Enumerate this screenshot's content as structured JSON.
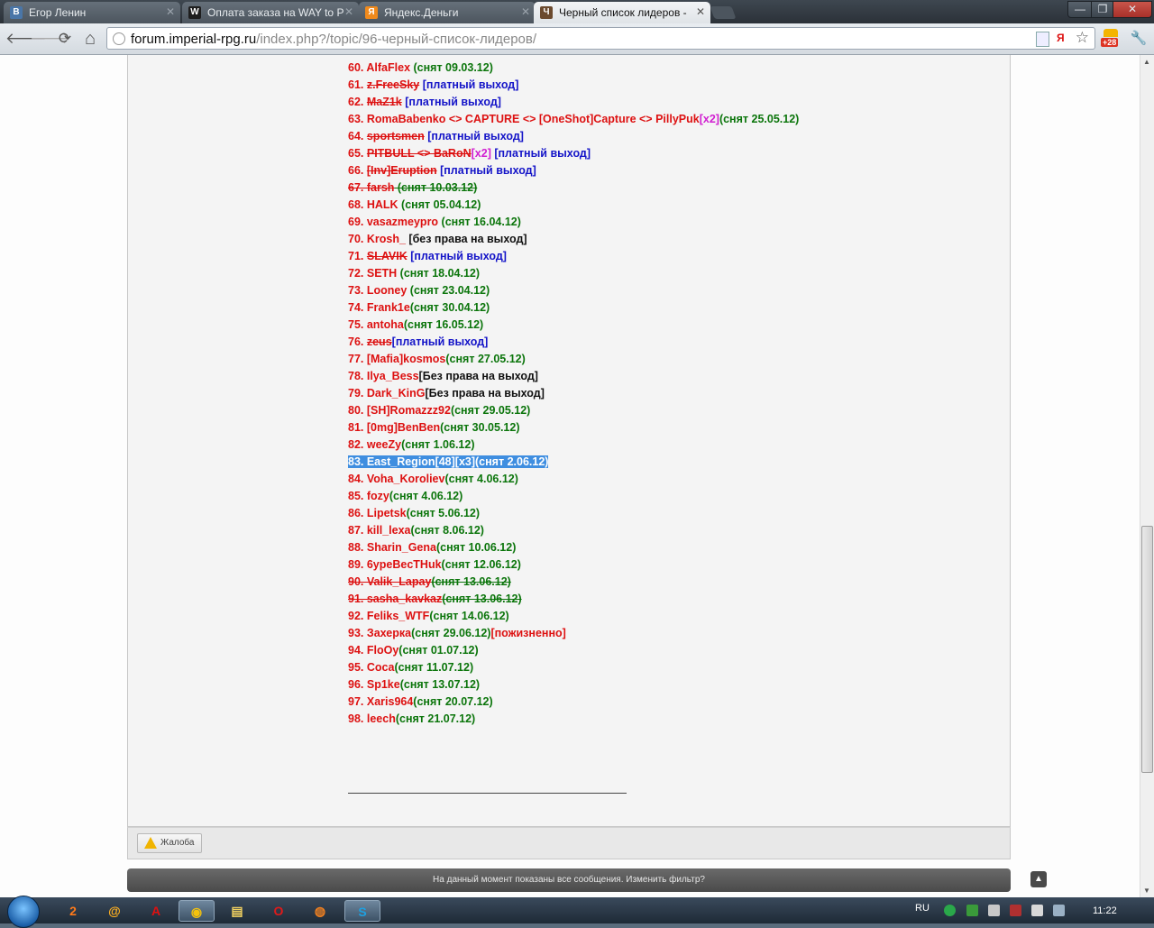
{
  "tabs": [
    {
      "title": "Егор Ленин",
      "fav_letter": "B",
      "fav_color": "#4a76a8"
    },
    {
      "title": "Оплата заказа на WAY to P",
      "fav_letter": "W",
      "fav_color": "#1e1e1e"
    },
    {
      "title": "Яндекс.Деньги",
      "fav_letter": "Я",
      "fav_color": "#f08a1c"
    },
    {
      "title": "Черный список лидеров -",
      "fav_letter": "Ч",
      "fav_color": "#6b4a2e"
    }
  ],
  "window_buttons": {
    "minimize": "—",
    "maximize": "❐",
    "close": "✕"
  },
  "toolbar": {
    "back": "🡐",
    "forward": "🡒",
    "reload": "⟳",
    "home": "⌂",
    "url_host": "forum.imperial-rpg.ru",
    "url_path": "/index.php?/topic/96-черный-список-лидеров/",
    "ext_badge": "+28",
    "bookmark_star": "☆",
    "wrench": "🔧"
  },
  "list": [
    {
      "segs": [
        {
          "t": "60. ",
          "c": "r"
        },
        {
          "t": "AlfaFlex",
          "c": "r"
        },
        {
          "t": " (снят 09.03.12)",
          "c": "g"
        }
      ]
    },
    {
      "segs": [
        {
          "t": "61. ",
          "c": "r"
        },
        {
          "t": "z.FreeSky",
          "c": "r s"
        },
        {
          "t": " [платный выход]",
          "c": "b"
        }
      ]
    },
    {
      "segs": [
        {
          "t": "62. ",
          "c": "r"
        },
        {
          "t": "MaZ1k",
          "c": "r s"
        },
        {
          "t": " [платный выход]",
          "c": "b"
        }
      ]
    },
    {
      "segs": [
        {
          "t": "63. ",
          "c": "r"
        },
        {
          "t": "RomaBabenko <> CAPTURE <> [OneShot]Capture <> PillyPuk",
          "c": "r"
        },
        {
          "t": "[x2]",
          "c": "m"
        },
        {
          "t": "(снят 25.05.12)",
          "c": "g"
        }
      ]
    },
    {
      "segs": [
        {
          "t": "64. ",
          "c": "r"
        },
        {
          "t": "sportsmen",
          "c": "r s"
        },
        {
          "t": " [платный выход]",
          "c": "b"
        }
      ]
    },
    {
      "segs": [
        {
          "t": "65. ",
          "c": "r"
        },
        {
          "t": "PITBULL <> BaRoN",
          "c": "r s"
        },
        {
          "t": "[x2]",
          "c": "m"
        },
        {
          "t": " [платный выход]",
          "c": "b"
        }
      ]
    },
    {
      "segs": [
        {
          "t": "66. ",
          "c": "r"
        },
        {
          "t": "[Inv]Eruption",
          "c": "r s"
        },
        {
          "t": " [платный выход]",
          "c": "b"
        }
      ]
    },
    {
      "segs": [
        {
          "t": "67. farsh",
          "c": "r s"
        },
        {
          "t": " (снят 10.03.12)",
          "c": "g s"
        }
      ]
    },
    {
      "segs": [
        {
          "t": "68. ",
          "c": "r"
        },
        {
          "t": "HALK",
          "c": "r"
        },
        {
          "t": " (снят 05.04.12)",
          "c": "g"
        }
      ]
    },
    {
      "segs": [
        {
          "t": "69. ",
          "c": "r"
        },
        {
          "t": "vasazmeypro",
          "c": "r"
        },
        {
          "t": " (снят 16.04.12)",
          "c": "g"
        }
      ]
    },
    {
      "segs": [
        {
          "t": "70. ",
          "c": "r"
        },
        {
          "t": "Krosh_",
          "c": "r"
        },
        {
          "t": " [без права на выход]",
          "c": "k"
        }
      ]
    },
    {
      "segs": [
        {
          "t": "71. ",
          "c": "r"
        },
        {
          "t": "SLAVIK",
          "c": "r s"
        },
        {
          "t": " [платный выход]",
          "c": "b"
        }
      ]
    },
    {
      "segs": [
        {
          "t": "72. ",
          "c": "r"
        },
        {
          "t": "SETH",
          "c": "r"
        },
        {
          "t": " (снят 18.04.12)",
          "c": "g"
        }
      ]
    },
    {
      "segs": [
        {
          "t": "73. ",
          "c": "r"
        },
        {
          "t": "Looney",
          "c": "r"
        },
        {
          "t": " (снят 23.04.12)",
          "c": "g"
        }
      ]
    },
    {
      "segs": [
        {
          "t": "74. ",
          "c": "r"
        },
        {
          "t": "Frank1e",
          "c": "r"
        },
        {
          "t": "(снят 30.04.12)",
          "c": "g"
        }
      ]
    },
    {
      "segs": [
        {
          "t": "75. ",
          "c": "r"
        },
        {
          "t": "antoha",
          "c": "r"
        },
        {
          "t": "(снят 16.05.12)",
          "c": "g"
        }
      ]
    },
    {
      "segs": [
        {
          "t": "76. ",
          "c": "r"
        },
        {
          "t": "zeus",
          "c": "r s"
        },
        {
          "t": "[платный выход]",
          "c": "b"
        }
      ]
    },
    {
      "segs": [
        {
          "t": "77. ",
          "c": "r"
        },
        {
          "t": "[Mafia]kosmos",
          "c": "r"
        },
        {
          "t": "(снят 27.05.12)",
          "c": "g"
        }
      ]
    },
    {
      "segs": [
        {
          "t": "78. ",
          "c": "r"
        },
        {
          "t": "Ilya_Bess",
          "c": "r"
        },
        {
          "t": "[Без права на выход]",
          "c": "k"
        }
      ]
    },
    {
      "segs": [
        {
          "t": "79. ",
          "c": "r"
        },
        {
          "t": "Dark_KinG",
          "c": "r"
        },
        {
          "t": "[Без права на выход]",
          "c": "k"
        }
      ]
    },
    {
      "segs": [
        {
          "t": "80. ",
          "c": "r"
        },
        {
          "t": "[SH]Romazzz92",
          "c": "r"
        },
        {
          "t": "(снят 29.05.12)",
          "c": "g"
        }
      ]
    },
    {
      "segs": [
        {
          "t": "81. ",
          "c": "r"
        },
        {
          "t": "[0mg]BenBen",
          "c": "r"
        },
        {
          "t": "(снят 30.05.12)",
          "c": "g"
        }
      ]
    },
    {
      "segs": [
        {
          "t": "82. ",
          "c": "r"
        },
        {
          "t": "weeZy",
          "c": "r"
        },
        {
          "t": "(снят 1.06.12)",
          "c": "g"
        }
      ]
    },
    {
      "selected": true,
      "segs": [
        {
          "t": "83. East_Region[48][x3](снят 2.06.12)",
          "c": "r"
        }
      ]
    },
    {
      "segs": [
        {
          "t": "84. ",
          "c": "r"
        },
        {
          "t": "Voha_Koroliev",
          "c": "r"
        },
        {
          "t": "(снят 4.06.12)",
          "c": "g"
        }
      ]
    },
    {
      "segs": [
        {
          "t": "85. ",
          "c": "r"
        },
        {
          "t": "fozy",
          "c": "r"
        },
        {
          "t": "(снят 4.06.12)",
          "c": "g"
        }
      ]
    },
    {
      "segs": [
        {
          "t": "86. ",
          "c": "r"
        },
        {
          "t": "Lipetsk",
          "c": "r"
        },
        {
          "t": "(снят 5.06.12)",
          "c": "g"
        }
      ]
    },
    {
      "segs": [
        {
          "t": "87. ",
          "c": "r"
        },
        {
          "t": "kill_lexa",
          "c": "r"
        },
        {
          "t": "(снят 8.06.12)",
          "c": "g"
        }
      ]
    },
    {
      "segs": [
        {
          "t": "88. ",
          "c": "r"
        },
        {
          "t": "Sharin_Gena",
          "c": "r"
        },
        {
          "t": "(снят 10.06.12)",
          "c": "g"
        }
      ]
    },
    {
      "segs": [
        {
          "t": "89. ",
          "c": "r"
        },
        {
          "t": "6ypeBecTHuk",
          "c": "r"
        },
        {
          "t": "(снят 12.06.12)",
          "c": "g"
        }
      ]
    },
    {
      "segs": [
        {
          "t": "90. Valik_Lapay",
          "c": "r s"
        },
        {
          "t": "(снят 13.06.12)",
          "c": "g s"
        }
      ]
    },
    {
      "segs": [
        {
          "t": "91. sasha_kavkaz",
          "c": "r s"
        },
        {
          "t": "(снят 13.06.12)",
          "c": "g s"
        }
      ]
    },
    {
      "segs": [
        {
          "t": "92. ",
          "c": "r"
        },
        {
          "t": "Feliks_WTF",
          "c": "r"
        },
        {
          "t": "(снят 14.06.12)",
          "c": "g"
        }
      ]
    },
    {
      "segs": [
        {
          "t": "93. ",
          "c": "r"
        },
        {
          "t": "Захерка",
          "c": "r"
        },
        {
          "t": "(снят 29.06.12)",
          "c": "g"
        },
        {
          "t": "[пожизненно]",
          "c": "r"
        }
      ]
    },
    {
      "segs": [
        {
          "t": "94. ",
          "c": "r"
        },
        {
          "t": "FloOy",
          "c": "r"
        },
        {
          "t": "(снят 01.07.12)",
          "c": "g"
        }
      ]
    },
    {
      "segs": [
        {
          "t": "95. ",
          "c": "r"
        },
        {
          "t": "Coca",
          "c": "r"
        },
        {
          "t": "(снят 11.07.12)",
          "c": "g"
        }
      ]
    },
    {
      "segs": [
        {
          "t": "96. ",
          "c": "r"
        },
        {
          "t": "Sp1ke",
          "c": "r"
        },
        {
          "t": "(снят 13.07.12)",
          "c": "g"
        }
      ]
    },
    {
      "segs": [
        {
          "t": "97. ",
          "c": "r"
        },
        {
          "t": "Xaris964",
          "c": "r"
        },
        {
          "t": "(снят 20.07.12)",
          "c": "g"
        }
      ]
    },
    {
      "segs": [
        {
          "t": "98. ",
          "c": "r"
        },
        {
          "t": "leech",
          "c": "r"
        },
        {
          "t": "(снят 21.07.12)",
          "c": "g"
        }
      ]
    }
  ],
  "post_footer": {
    "report_label": "Жалоба"
  },
  "filter_bar": {
    "text": "На данный момент показаны все сообщения. Изменить фильтр?",
    "to_top": "▲"
  },
  "taskbar": {
    "apps": [
      {
        "name": "taskbar-app-1",
        "glyph": "2",
        "color": "#ff7a1a",
        "on": false
      },
      {
        "name": "taskbar-app-2",
        "glyph": "@",
        "color": "#ffb020",
        "on": false
      },
      {
        "name": "taskbar-app-3",
        "glyph": "A",
        "color": "#e01010",
        "on": false
      },
      {
        "name": "taskbar-chrome",
        "glyph": "◉",
        "color": "#f4c20d",
        "on": true
      },
      {
        "name": "taskbar-explorer",
        "glyph": "▤",
        "color": "#f0d060",
        "on": false
      },
      {
        "name": "taskbar-opera",
        "glyph": "O",
        "color": "#e01a1a",
        "on": false
      },
      {
        "name": "taskbar-firefox",
        "glyph": "◍",
        "color": "#f08020",
        "on": false
      },
      {
        "name": "taskbar-skype",
        "glyph": "S",
        "color": "#1ea0e0",
        "on": true
      }
    ],
    "lang": "RU",
    "clock": "11:22"
  },
  "colors": {
    "red": "#dd1111",
    "green": "#0b750b",
    "blue": "#1414c8",
    "magenta": "#d11fd1",
    "selection": "#3f8ee0"
  }
}
